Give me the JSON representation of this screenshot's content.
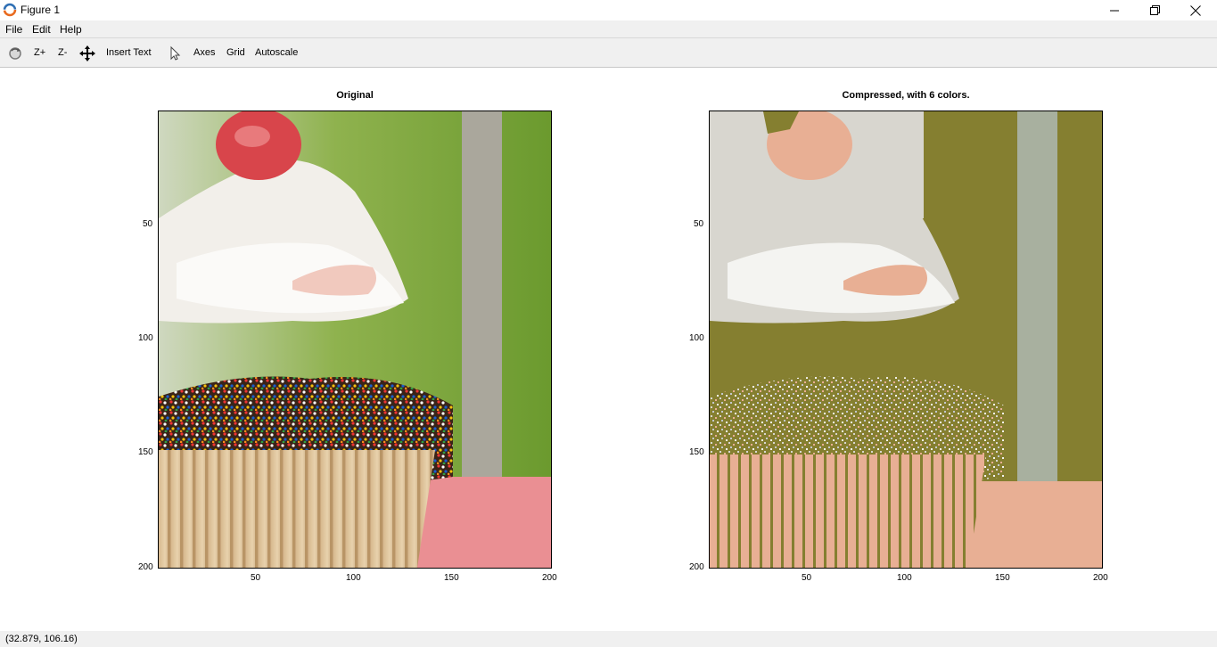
{
  "window": {
    "title": "Figure 1",
    "icon": "octave-logo-icon"
  },
  "menu": {
    "items": [
      "File",
      "Edit",
      "Help"
    ]
  },
  "toolbar": {
    "rotate_icon": "rotate-icon",
    "zoom_in": "Z+",
    "zoom_out": "Z-",
    "pan_icon": "pan-move-icon",
    "insert_text": "Insert Text",
    "select_icon": "select-pointer-icon",
    "axes": "Axes",
    "grid": "Grid",
    "autoscale": "Autoscale"
  },
  "plots": [
    {
      "title": "Original",
      "xticks": [
        "50",
        "100",
        "150",
        "200"
      ],
      "yticks": [
        "50",
        "100",
        "150",
        "200"
      ],
      "image": "cupcake-photo"
    },
    {
      "title": "Compressed, with 6 colors.",
      "xticks": [
        "50",
        "100",
        "150",
        "200"
      ],
      "yticks": [
        "50",
        "100",
        "150",
        "200"
      ],
      "image": "cupcake-6-color-quantized",
      "palette": [
        "#857f30",
        "#e8af94",
        "#d8d6cf",
        "#f4f4f1",
        "#a8b09f",
        "#c4c8cc"
      ]
    }
  ],
  "status": {
    "coords": "(32.879, 106.16)"
  }
}
